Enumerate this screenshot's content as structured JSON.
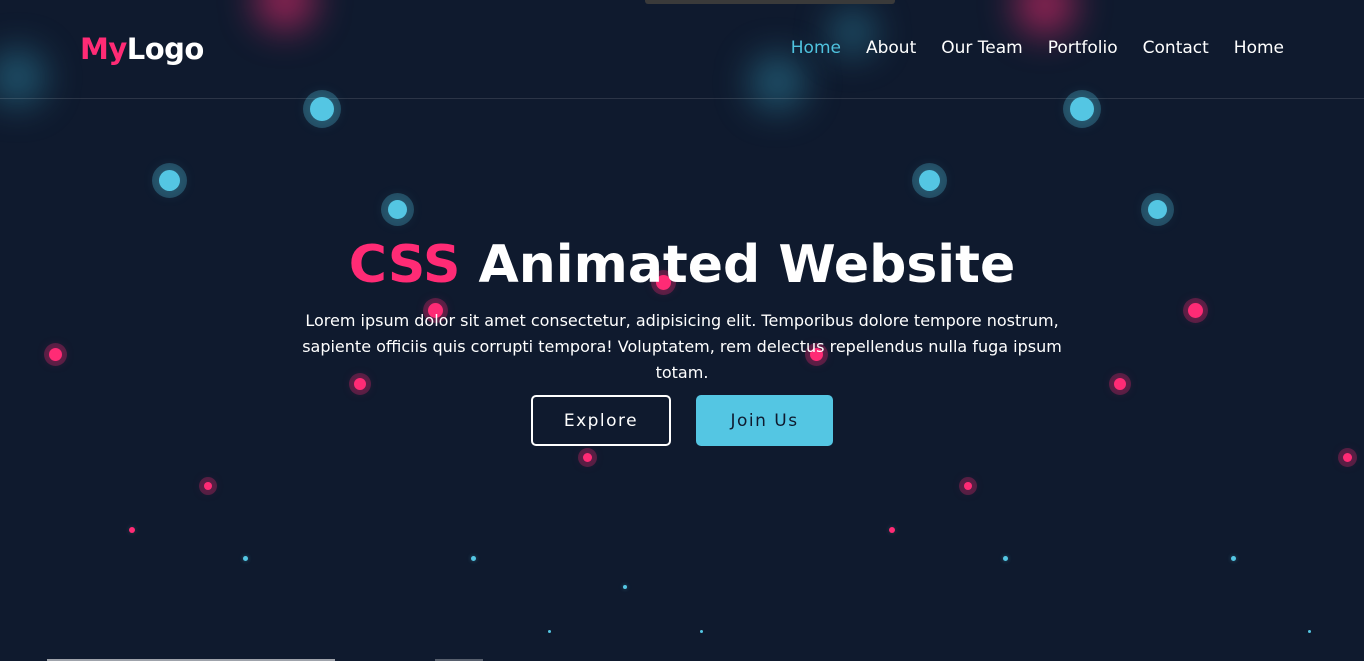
{
  "logo": {
    "part_a": "My",
    "part_b": "Logo"
  },
  "nav": {
    "items": [
      {
        "label": "Home",
        "active": true
      },
      {
        "label": "About",
        "active": false
      },
      {
        "label": "Our Team",
        "active": false
      },
      {
        "label": "Portfolio",
        "active": false
      },
      {
        "label": "Contact",
        "active": false
      },
      {
        "label": "Home",
        "active": false
      }
    ]
  },
  "hero": {
    "title_accent": "CSS",
    "title_rest": "Animated Website",
    "text": "Lorem ipsum dolor sit amet consectetur, adipisicing elit. Temporibus dolore tempore nostrum, sapiente officiis quis corrupti tempora! Voluptatem, rem delectus repellendus nulla fuga ipsum totam.",
    "explore_label": "Explore",
    "join_label": "Join Us"
  },
  "colors": {
    "background": "#0f1a2e",
    "accent_pink": "#ff2b75",
    "accent_blue": "#54c6e3",
    "text": "#ffffff"
  }
}
